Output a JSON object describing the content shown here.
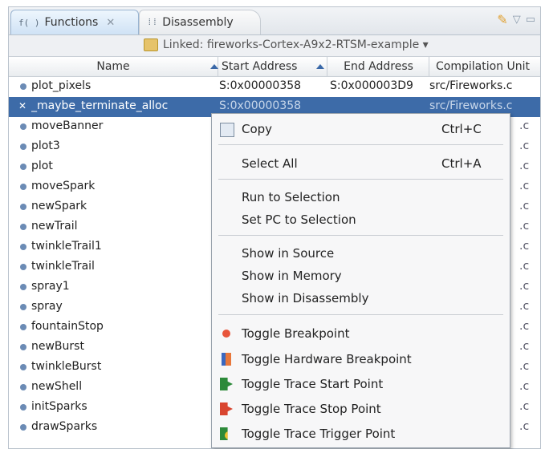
{
  "tabs": [
    {
      "label": "Functions",
      "icon": "functions-icon",
      "active": true
    },
    {
      "label": "Disassembly",
      "icon": "disassembly-icon",
      "active": false
    }
  ],
  "linked_label": "Linked: fireworks-Cortex-A9x2-RTSM-example ▾",
  "columns": {
    "name": "Name",
    "start": "Start Address",
    "end": "End Address",
    "unit": "Compilation Unit"
  },
  "rows": [
    {
      "name": "plot_pixels",
      "start": "S:0x00000358",
      "end": "S:0x000003D9",
      "unit": "src/Fireworks.c"
    },
    {
      "name": "_maybe_terminate_alloc",
      "start": "S:0x00000358",
      "end": "",
      "unit": "src/Fireworks.c",
      "selected": true
    },
    {
      "name": "moveBanner"
    },
    {
      "name": "plot3"
    },
    {
      "name": "plot"
    },
    {
      "name": "moveSpark"
    },
    {
      "name": "newSpark"
    },
    {
      "name": "newTrail"
    },
    {
      "name": "twinkleTrail1"
    },
    {
      "name": "twinkleTrail"
    },
    {
      "name": "spray1"
    },
    {
      "name": "spray"
    },
    {
      "name": "fountainStop"
    },
    {
      "name": "newBurst"
    },
    {
      "name": "twinkleBurst"
    },
    {
      "name": "newShell"
    },
    {
      "name": "initSparks"
    },
    {
      "name": "drawSparks"
    }
  ],
  "partial_unit_text": ".c",
  "context_menu": {
    "items": [
      {
        "label": "Copy",
        "accel": "Ctrl+C",
        "icon": "copy-icon"
      },
      {
        "label": "Select All",
        "accel": "Ctrl+A"
      },
      {
        "label": "Run to Selection"
      },
      {
        "label": "Set PC to Selection"
      },
      {
        "label": "Show in Source"
      },
      {
        "label": "Show in Memory"
      },
      {
        "label": "Show in Disassembly"
      },
      {
        "label": "Toggle Breakpoint",
        "icon": "breakpoint-icon"
      },
      {
        "label": "Toggle Hardware Breakpoint",
        "icon": "hardware-breakpoint-icon"
      },
      {
        "label": "Toggle Trace Start Point",
        "icon": "trace-start-icon"
      },
      {
        "label": "Toggle Trace Stop Point",
        "icon": "trace-stop-icon"
      },
      {
        "label": "Toggle Trace Trigger Point",
        "icon": "trace-trigger-icon"
      }
    ]
  }
}
